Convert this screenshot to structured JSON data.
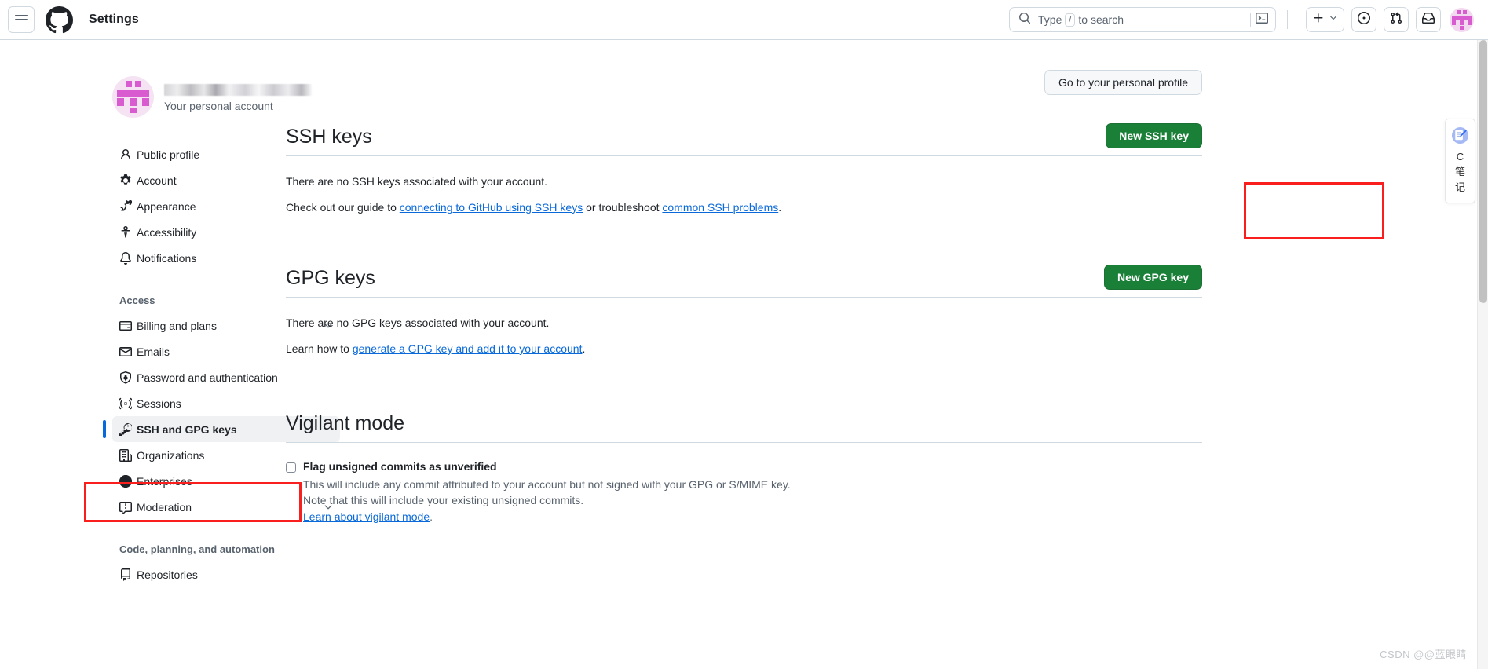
{
  "header": {
    "menu_icon": "hamburger-icon",
    "logo_icon": "github-logo-icon",
    "title": "Settings",
    "search": {
      "placeholder_before": "Type",
      "placeholder_key": "/",
      "placeholder_after": "to search",
      "search_icon": "search-icon",
      "terminal_icon": "terminal-icon"
    },
    "create_button": {
      "icon": "plus-icon",
      "caret": "chevron-down-icon"
    },
    "issues_button": {
      "icon": "issue-opened-icon"
    },
    "pulls_button": {
      "icon": "git-pull-request-icon"
    },
    "inbox_button": {
      "icon": "inbox-icon"
    },
    "avatar": {
      "icon": "user-avatar-identicon"
    }
  },
  "sidebar": {
    "account": {
      "avatar_icon": "user-avatar-identicon",
      "name_redacted": "",
      "subtitle": "Your personal account"
    },
    "top_items": [
      {
        "label": "Public profile",
        "icon": "person-icon",
        "active": false,
        "chevron": false
      },
      {
        "label": "Account",
        "icon": "gear-icon",
        "active": false,
        "chevron": false
      },
      {
        "label": "Appearance",
        "icon": "paintbrush-icon",
        "active": false,
        "chevron": false
      },
      {
        "label": "Accessibility",
        "icon": "accessibility-icon",
        "active": false,
        "chevron": false
      },
      {
        "label": "Notifications",
        "icon": "bell-icon",
        "active": false,
        "chevron": false
      }
    ],
    "groups": [
      {
        "title": "Access",
        "items": [
          {
            "label": "Billing and plans",
            "icon": "credit-card-icon",
            "active": false,
            "chevron": true
          },
          {
            "label": "Emails",
            "icon": "mail-icon",
            "active": false,
            "chevron": false
          },
          {
            "label": "Password and authentication",
            "icon": "shield-lock-icon",
            "active": false,
            "chevron": false
          },
          {
            "label": "Sessions",
            "icon": "broadcast-icon",
            "active": false,
            "chevron": false
          },
          {
            "label": "SSH and GPG keys",
            "icon": "key-icon",
            "active": true,
            "chevron": false
          },
          {
            "label": "Organizations",
            "icon": "organization-icon",
            "active": false,
            "chevron": false
          },
          {
            "label": "Enterprises",
            "icon": "globe-icon",
            "active": false,
            "chevron": false
          },
          {
            "label": "Moderation",
            "icon": "report-icon",
            "active": false,
            "chevron": true
          }
        ]
      },
      {
        "title": "Code, planning, and automation",
        "items": [
          {
            "label": "Repositories",
            "icon": "repo-icon",
            "active": false,
            "chevron": false
          }
        ]
      }
    ]
  },
  "main": {
    "profile_button": "Go to your personal profile",
    "ssh": {
      "title": "SSH keys",
      "new_button": "New SSH key",
      "empty_text": "There are no SSH keys associated with your account.",
      "guide_prefix": "Check out our guide to ",
      "guide_link": "connecting to GitHub using SSH keys",
      "guide_middle": " or troubleshoot ",
      "guide_link2": "common SSH problems",
      "guide_suffix": "."
    },
    "gpg": {
      "title": "GPG keys",
      "new_button": "New GPG key",
      "empty_text": "There are no GPG keys associated with your account.",
      "learn_prefix": "Learn how to ",
      "learn_link": "generate a GPG key and add it to your account",
      "learn_suffix": "."
    },
    "vigilant": {
      "title": "Vigilant mode",
      "checkbox_label": "Flag unsigned commits as unverified",
      "note_line1": "This will include any commit attributed to your account but not signed with your GPG or S/MIME key.",
      "note_line2": "Note that this will include your existing unsigned commits.",
      "learn_link": "Learn about vigilant mode",
      "learn_suffix": "."
    }
  },
  "float_widget": {
    "icon": "note-pen-icon",
    "line1": "C",
    "line2": "笔",
    "line3": "记"
  },
  "watermark": "CSDN @@蓝眼睛",
  "colors": {
    "accent_blue": "#0969da",
    "green_button": "#1a7f37",
    "annotation_red": "#f91f1f",
    "avatar_pink": "#d95bd0"
  }
}
